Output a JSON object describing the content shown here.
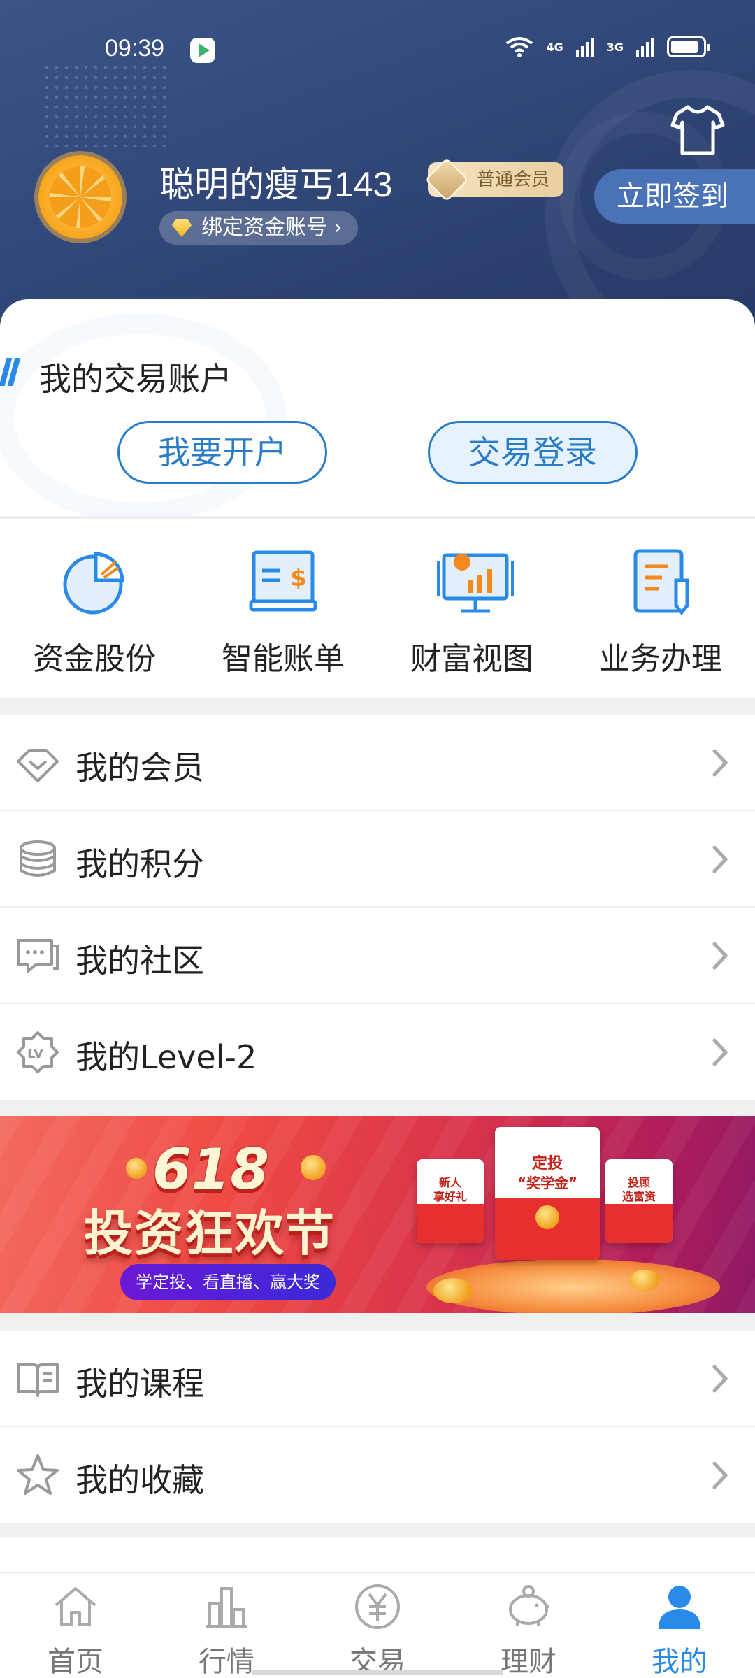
{
  "status_bar": {
    "time": "09:39",
    "signal_1": "4G",
    "signal_2": "3G"
  },
  "profile": {
    "username": "聪明的瘦丐143",
    "member_level": "普通会员",
    "bind_account": "绑定资金账号",
    "checkin_button": "立即签到"
  },
  "trade_account": {
    "title": "我的交易账户",
    "open_account_button": "我要开户",
    "login_button": "交易登录"
  },
  "quick_entries": [
    {
      "label": "资金股份",
      "icon": "pie-chart-icon"
    },
    {
      "label": "智能账单",
      "icon": "bill-icon"
    },
    {
      "label": "财富视图",
      "icon": "wealth-board-icon"
    },
    {
      "label": "业务办理",
      "icon": "document-pen-icon"
    }
  ],
  "menu_group_1": [
    {
      "label": "我的会员",
      "icon": "diamond-icon"
    },
    {
      "label": "我的积分",
      "icon": "coins-stack-icon"
    },
    {
      "label": "我的社区",
      "icon": "chat-bubble-icon"
    },
    {
      "label": "我的Level-2",
      "icon": "lv-badge-icon"
    }
  ],
  "banner": {
    "big": "618",
    "title": "投资狂欢节",
    "subtitle": "学定投、看直播、赢大奖",
    "card_center_line1": "定投",
    "card_center_line2": "“奖学金”",
    "card_left": "新人\n享好礼",
    "card_right": "投顾\n选富资"
  },
  "menu_group_2": [
    {
      "label": "我的课程",
      "icon": "book-icon"
    },
    {
      "label": "我的收藏",
      "icon": "star-icon"
    }
  ],
  "tabbar": [
    {
      "label": "首页",
      "icon": "home-icon",
      "active": false
    },
    {
      "label": "行情",
      "icon": "market-chart-icon",
      "active": false
    },
    {
      "label": "交易",
      "icon": "yuan-circle-icon",
      "active": false
    },
    {
      "label": "理财",
      "icon": "piggy-bank-icon",
      "active": false
    },
    {
      "label": "我的",
      "icon": "user-icon",
      "active": true
    }
  ],
  "colors": {
    "header": "#2f4576",
    "accent": "#2a8ae8",
    "button_border": "#2a7cc7"
  }
}
